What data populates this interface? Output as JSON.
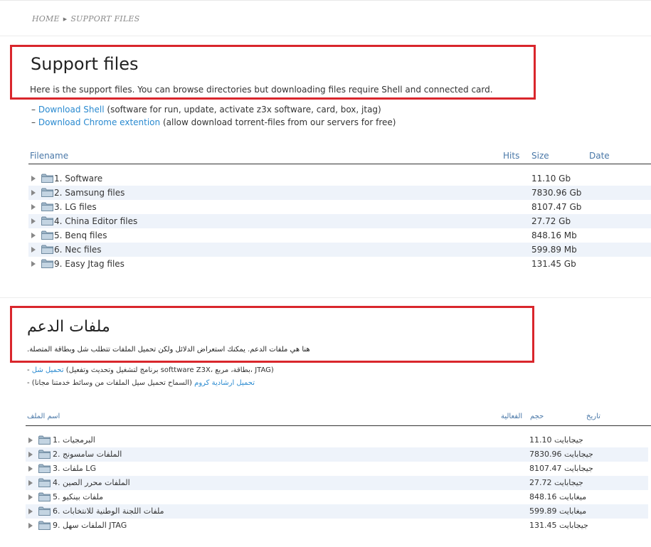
{
  "breadcrumb": {
    "home": "HOME",
    "current": "SUPPORT FILES"
  },
  "en": {
    "title": "Support files",
    "description": "Here is the support files. You can browse directories but downloading files require Shell and connected card.",
    "links": [
      {
        "bullet": "–",
        "link": "Download Shell",
        "note": "(software for run, update, activate z3x software, card, box, jtag)"
      },
      {
        "bullet": "–",
        "link": "Download Chrome extention",
        "note": "(allow download torrent-files from our servers for free)"
      }
    ],
    "columns": {
      "filename": "Filename",
      "hits": "Hits",
      "size": "Size",
      "date": "Date"
    },
    "rows": [
      {
        "name": "1. Software",
        "size": "11.10 Gb"
      },
      {
        "name": "2. Samsung files",
        "size": "7830.96 Gb"
      },
      {
        "name": "3. LG files",
        "size": "8107.47 Gb"
      },
      {
        "name": "4. China Editor files",
        "size": "27.72 Gb"
      },
      {
        "name": "5. Benq files",
        "size": "848.16 Mb"
      },
      {
        "name": "6. Nec files",
        "size": "599.89 Mb"
      },
      {
        "name": "9. Easy Jtag files",
        "size": "131.45 Gb"
      }
    ]
  },
  "ar": {
    "title": "ملفات الدعم",
    "description": ".هنا هي ملفات الدعم. يمكنك استعراض الدلائل ولكن تحميل الملفات تتطلب شل وبطاقة المتصلة",
    "links": [
      {
        "bullet": "-",
        "link": "تحميل شل",
        "note": "(برنامج لتشغيل وتحديث وتفعيل softtware Z3X، بطاقة، مربع، JTAG)"
      },
      {
        "bullet": "-",
        "link": "تحميل ارشادية كروم",
        "note": "(السماح تحميل سيل الملفات من وسائط خدمتنا مجانا)"
      }
    ],
    "columns": {
      "filename": "اسم الملف",
      "hits": "الفعالية",
      "size": "حجم",
      "date": "تاريخ"
    },
    "rows": [
      {
        "name": "البرمجيات .1",
        "size": "11.10 جيجابايت"
      },
      {
        "name": "الملفات سامسونج .2",
        "size": "7830.96 جيجابايت"
      },
      {
        "name": "3. ملفات LG",
        "size": "8107.47 جيجابايت"
      },
      {
        "name": "الملفات محرر الصين .4",
        "size": "27.72 جيجابايت"
      },
      {
        "name": "ملفات بينكيو .5",
        "size": "848.16 ميغابايت"
      },
      {
        "name": "ملفات اللجنة الوطنية للانتخابات .6",
        "size": "599.89 ميغابايت"
      },
      {
        "name": "9. الملفات سهل JTAG",
        "size": "131.45 جيجابايت"
      }
    ]
  },
  "colors": {
    "accent_red": "#d9262c",
    "link_blue": "#2a8ad0",
    "row_alt": "#eef3fa",
    "header_text": "#4a78a8"
  },
  "icons": {
    "row_expand": "triangle-right-icon",
    "folder": "folder-icon",
    "breadcrumb_sep": "triangle-right-icon"
  }
}
